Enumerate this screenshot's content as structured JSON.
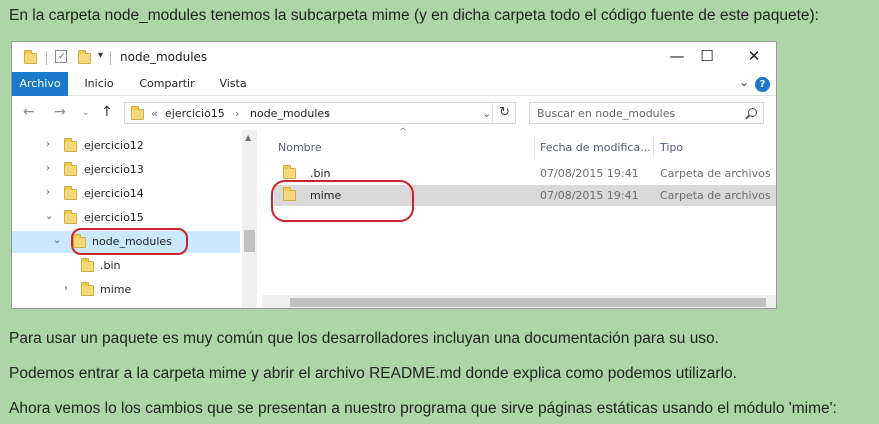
{
  "paragraphs": {
    "intro": "En la carpeta node_modules tenemos la subcarpeta mime (y en dicha carpeta todo el código fuente de este paquete):",
    "p2": "Para usar un paquete es muy común que los desarrolladores incluyan una documentación para su uso.",
    "p3": "Podemos entrar a la carpeta mime y abrir el archivo README.md donde explica como podemos utilizarlo.",
    "p4": "Ahora vemos lo los cambios que se presentan a nuestro programa que sirve páginas estáticas usando el módulo 'mime':"
  },
  "window": {
    "title": "node_modules",
    "ribbon_tabs": [
      "Archivo",
      "Inicio",
      "Compartir",
      "Vista"
    ],
    "address": {
      "prefix": "«",
      "crumbs": [
        "ejercicio15",
        "node_modules"
      ]
    },
    "search_placeholder": "Buscar en node_modules",
    "tree": [
      {
        "label": "ejercicio12",
        "expanded": false
      },
      {
        "label": "ejercicio13",
        "expanded": false
      },
      {
        "label": "ejercicio14",
        "expanded": false
      },
      {
        "label": "ejercicio15",
        "expanded": true
      },
      {
        "label": "node_modules",
        "expanded": true,
        "selected": true
      },
      {
        "label": ".bin",
        "expanded": false
      },
      {
        "label": "mime",
        "expanded": false
      }
    ],
    "columns": [
      "Nombre",
      "Fecha de modifica...",
      "Tipo"
    ],
    "files": [
      {
        "name": ".bin",
        "date": "07/08/2015 19:41",
        "type": "Carpeta de archivos",
        "selected": false
      },
      {
        "name": "mime",
        "date": "07/08/2015 19:41",
        "type": "Carpeta de archivos",
        "selected": true
      }
    ]
  },
  "colors": {
    "page_bg": "#add6a7",
    "accent": "#1979ca",
    "highlight_circle": "#c9242b"
  }
}
